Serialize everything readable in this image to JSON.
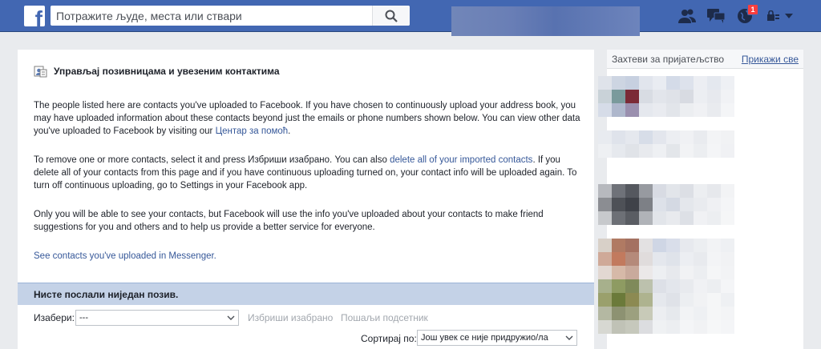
{
  "topbar": {
    "logo_letter": "f",
    "search_placeholder": "Потражите људе, места или ствари",
    "notification_count": "1",
    "brand_color": "#4267b2"
  },
  "main": {
    "title": "Управљај позивницама и увезеним контактима",
    "para1_text": "The people listed here are contacts you've uploaded to Facebook. If you have chosen to continuously upload your address book, you may have uploaded information about these contacts beyond just the emails or phone numbers shown below. You can view other data you've uploaded to Facebook by visiting our ",
    "para1_link": "Центар за помоћ",
    "para1_end": ".",
    "para2_text1": "To remove one or more contacts, select it and press Избриши изабрано. You can also ",
    "para2_link": "delete all of your imported contacts",
    "para2_text2": ". If you delete all of your contacts from this page and if you have continuous uploading turned on, your contact info will be uploaded again. To turn off continuous uploading, go to Settings in your Facebook app.",
    "para3_text": "Only you will be able to see your contacts, but Facebook will use the info you've uploaded about your contacts to make friend suggestions for you and others and to help us provide a better service for everyone.",
    "messenger_link": "See contacts you've uploaded in Messenger.",
    "status_bar": "Нисте послали ниједан позив.",
    "select_label": "Изабери:",
    "select_value": "---",
    "delete_selected": "Избриши изабрано",
    "send_reminder": "Пошаљи подсетник",
    "sort_label": "Сортирај по:",
    "sort_value": "Још увек се није придружио/ла"
  },
  "sidebar": {
    "title": "Захтеви за пријатељство",
    "see_all": "Прикажи све"
  },
  "icons": [
    "facebook-logo-icon",
    "search-icon",
    "friends-icon",
    "messages-icon",
    "globe-icon",
    "lock-icon",
    "menu-caret-icon",
    "contacts-icon",
    "chevron-down-icon"
  ]
}
